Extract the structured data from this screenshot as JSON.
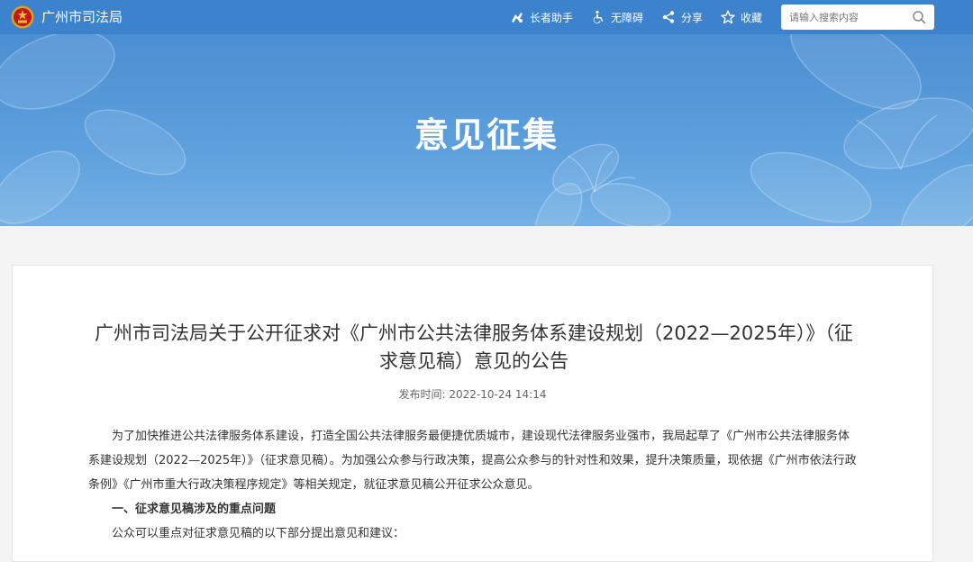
{
  "header": {
    "site_name": "广州市司法局",
    "tools": {
      "elder": "长者助手",
      "accessibility": "无障碍",
      "share": "分享",
      "favorite": "收藏"
    },
    "search": {
      "placeholder": "请输入搜索内容",
      "value": ""
    }
  },
  "banner": {
    "title": "意见征集"
  },
  "article": {
    "title": "广州市司法局关于公开征求对《广州市公共法律服务体系建设规划（2022—2025年）》（征求意见稿）意见的公告",
    "publish_label": "发布时间:",
    "publish_time": "2022-10-24 14:14",
    "paragraphs": [
      "为了加快推进公共法律服务体系建设，打造全国公共法律服务最便捷优质城市，建设现代法律服务业强市，我局起草了《广州市公共法律服务体系建设规划（2022—2025年）》（征求意见稿）。为加强公众参与行政决策，提高公众参与的针对性和效果，提升决策质量，现依据《广州市依法行政条例》《广州市重大行政决策程序规定》等相关规定，就征求意见稿公开征求公众意见。",
      "一、征求意见稿涉及的重点问题",
      "公众可以重点对征求意见稿的以下部分提出意见和建议："
    ]
  },
  "colors": {
    "header_bg": "#3d82cc",
    "banner_bg": "#5da0dd",
    "page_bg": "#f4f4f4"
  },
  "icons": [
    "national-emblem-icon",
    "elder-helper-icon",
    "accessibility-icon",
    "share-icon",
    "star-icon",
    "search-icon"
  ]
}
